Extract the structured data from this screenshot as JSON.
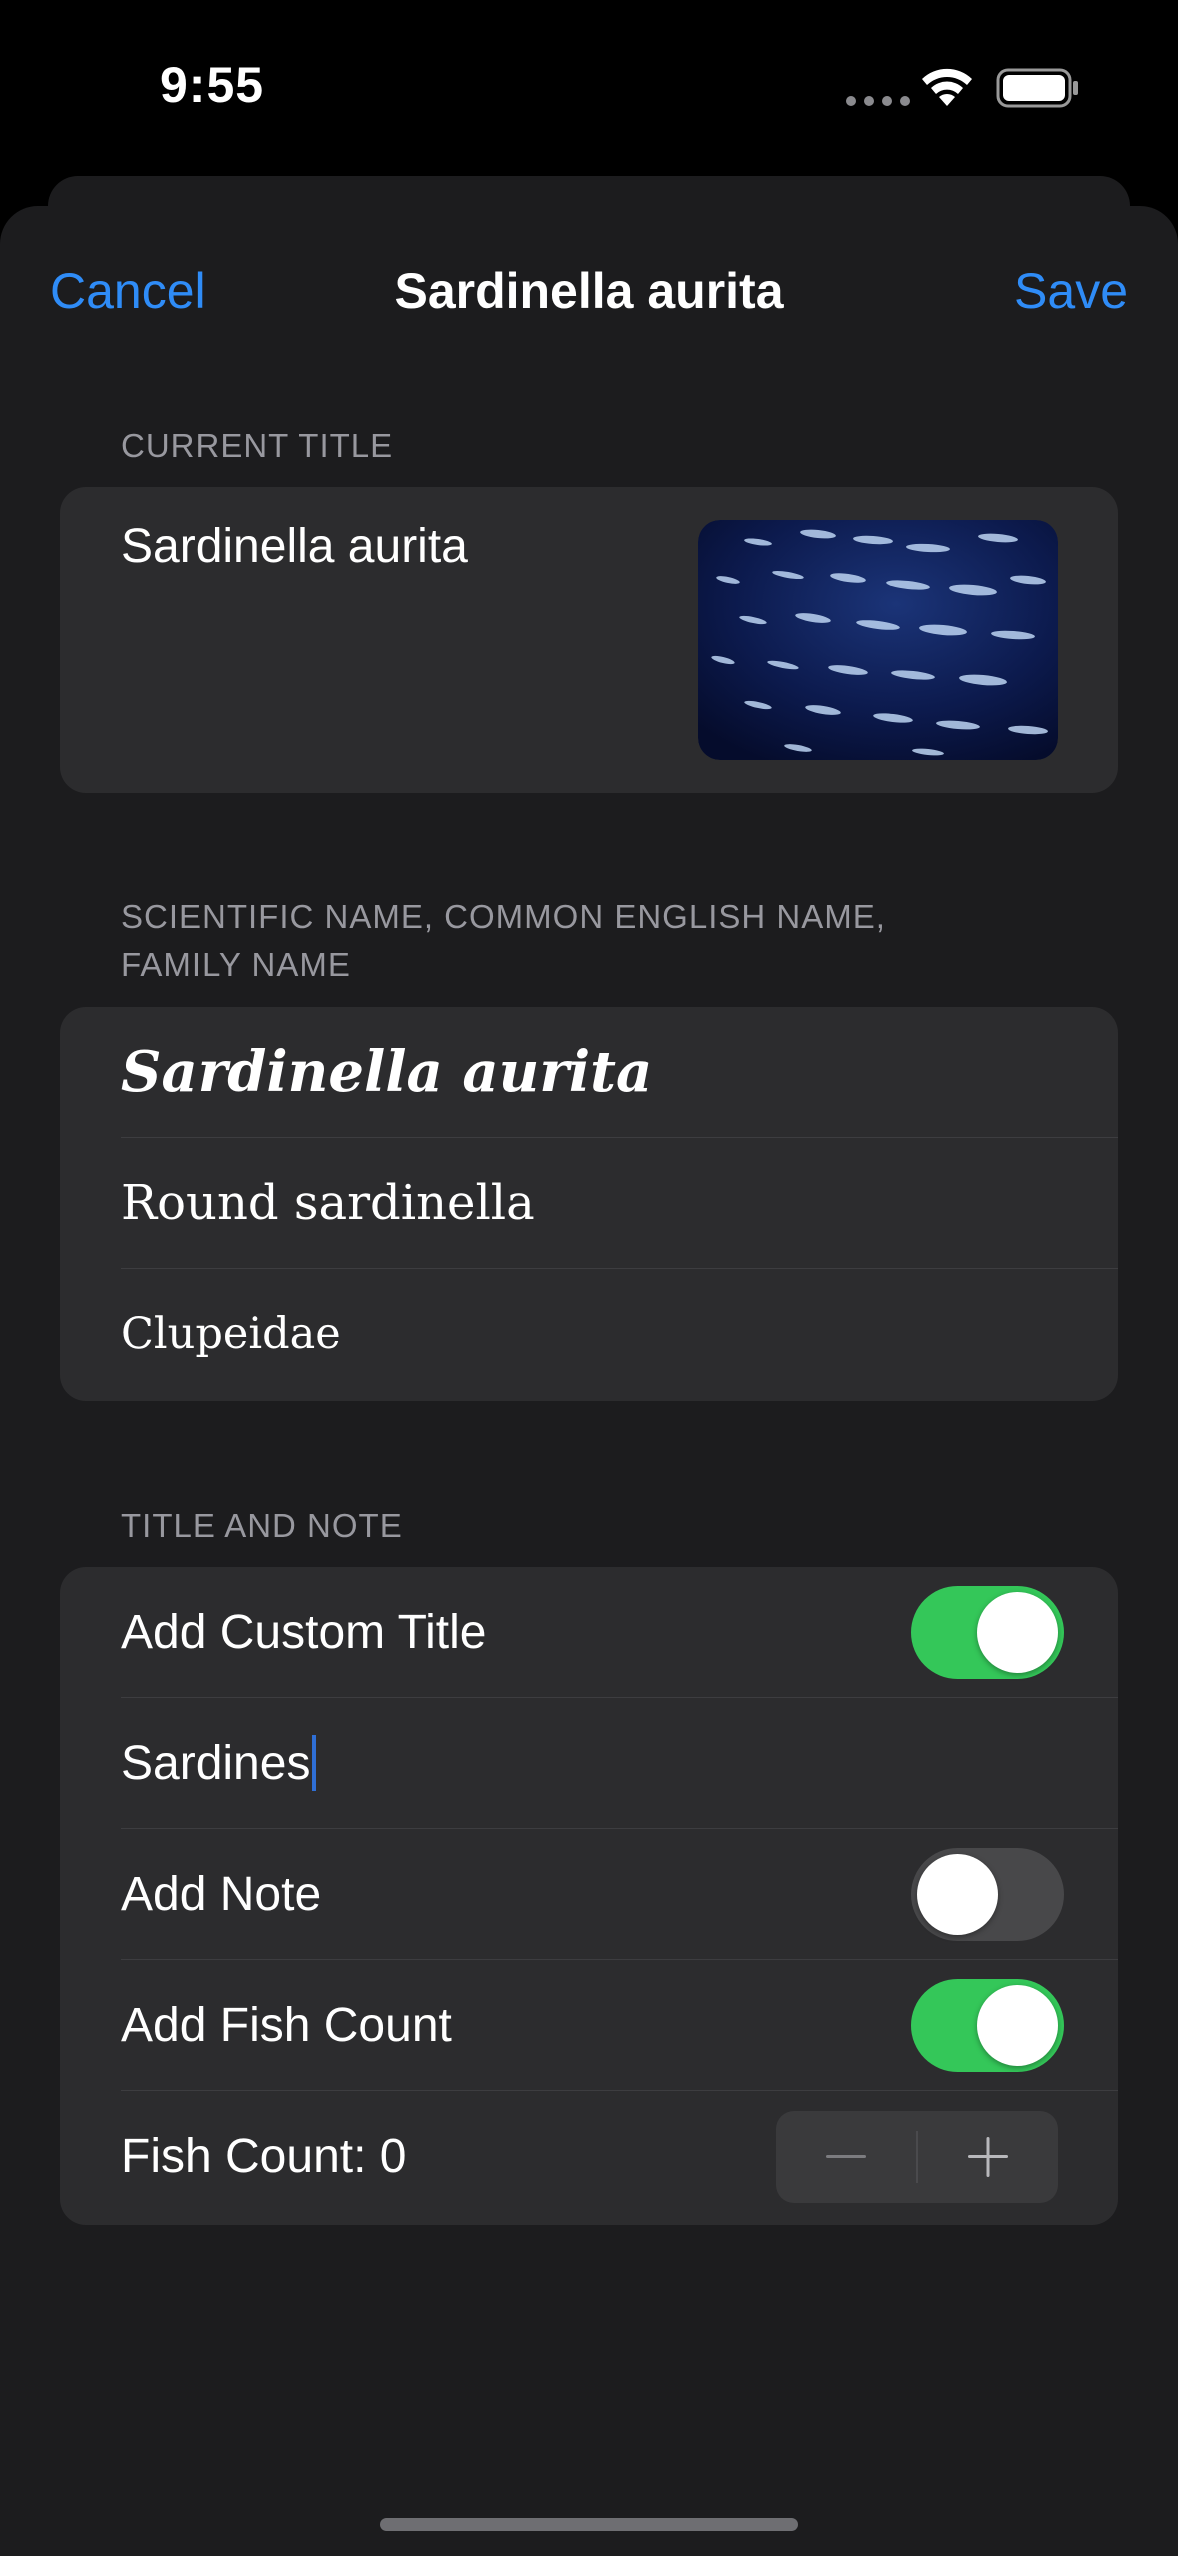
{
  "status_bar": {
    "time": "9:55"
  },
  "nav": {
    "cancel_label": "Cancel",
    "title": "Sardinella aurita",
    "save_label": "Save"
  },
  "sections": {
    "current_title": {
      "header": "CURRENT TITLE",
      "title_value": "Sardinella aurita"
    },
    "names": {
      "header_line1": "SCIENTIFIC NAME, COMMON ENGLISH NAME,",
      "header_line2": "FAMILY NAME",
      "scientific_name": "Sardinella aurita",
      "common_name": "Round sardinella",
      "family_name": "Clupeidae"
    },
    "title_and_note": {
      "header": "TITLE AND NOTE",
      "custom_title_label": "Add Custom Title",
      "custom_title_on": true,
      "custom_title_value": "Sardines",
      "add_note_label": "Add Note",
      "add_note_on": false,
      "fish_count_toggle_label": "Add Fish Count",
      "fish_count_on": true,
      "fish_count_label": "Fish Count: 0"
    }
  },
  "colors": {
    "accent": "#2f8cf7",
    "toggle_on": "#34c759",
    "toggle_off": "#48484a",
    "card_bg": "#2c2c2e",
    "sheet_bg": "#1c1c1e"
  },
  "icons": [
    "wifi-icon",
    "battery-icon",
    "signal-dots-icon",
    "minus-icon",
    "plus-icon",
    "fish-school-thumbnail"
  ]
}
